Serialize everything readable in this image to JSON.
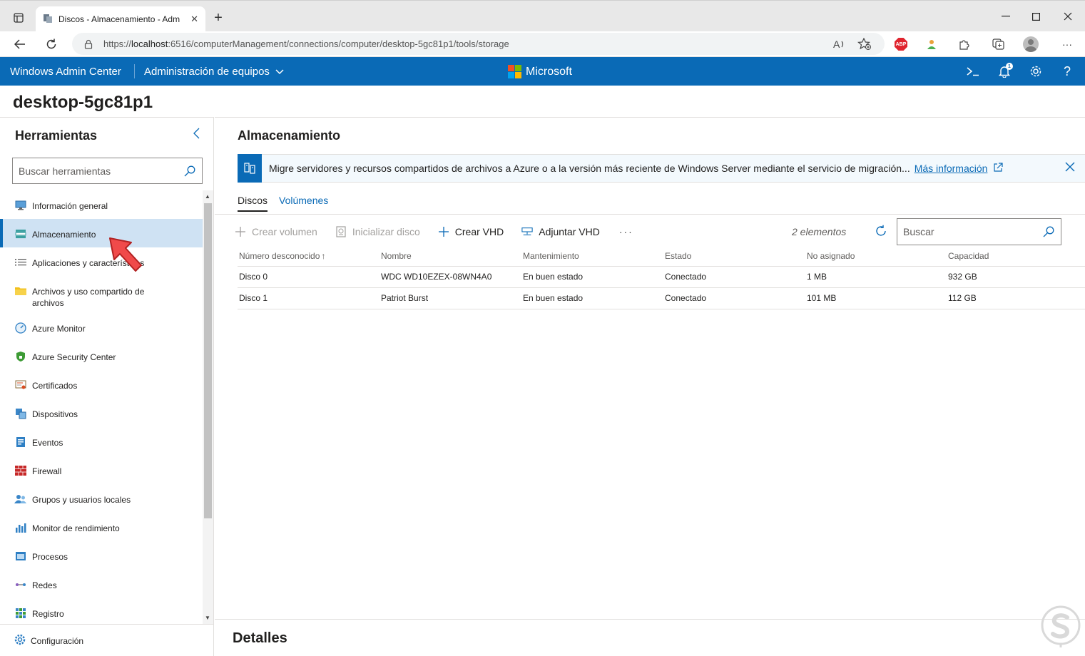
{
  "browser": {
    "tab_title": "Discos - Almacenamiento - Adm",
    "url_prefix": "https://",
    "url_host": "localhost",
    "url_rest": ":6516/computerManagement/connections/computer/desktop-5gc81p1/tools/storage"
  },
  "app": {
    "title": "Windows Admin Center",
    "context": "Administración de equipos",
    "brand": "Microsoft",
    "notification_count": "1",
    "accent_color": "#0a6ab6"
  },
  "machine_name": "desktop-5gc81p1",
  "sidebar": {
    "title": "Herramientas",
    "search_placeholder": "Buscar herramientas",
    "items": [
      {
        "label": "Información general",
        "icon": "monitor-icon"
      },
      {
        "label": "Almacenamiento",
        "icon": "storage-icon"
      },
      {
        "label": "Aplicaciones y características",
        "icon": "list-icon"
      },
      {
        "label": "Archivos y uso compartido de archivos",
        "icon": "folder-icon"
      },
      {
        "label": "Azure Monitor",
        "icon": "gauge-icon"
      },
      {
        "label": "Azure Security Center",
        "icon": "shield-icon"
      },
      {
        "label": "Certificados",
        "icon": "certificate-icon"
      },
      {
        "label": "Dispositivos",
        "icon": "devices-icon"
      },
      {
        "label": "Eventos",
        "icon": "event-log-icon"
      },
      {
        "label": "Firewall",
        "icon": "firewall-icon"
      },
      {
        "label": "Grupos y usuarios locales",
        "icon": "users-icon"
      },
      {
        "label": "Monitor de rendimiento",
        "icon": "chart-icon"
      },
      {
        "label": "Procesos",
        "icon": "process-icon"
      },
      {
        "label": "Redes",
        "icon": "network-icon"
      },
      {
        "label": "Registro",
        "icon": "registry-icon"
      }
    ],
    "footer": "Configuración"
  },
  "main": {
    "title": "Almacenamiento",
    "banner": {
      "message": "Migre servidores y recursos compartidos de archivos a Azure o a la versión más reciente de Windows Server mediante el servicio de migración...",
      "link": "Más información"
    },
    "tabs": [
      "Discos",
      "Volúmenes"
    ],
    "commands": {
      "create_volume": "Crear volumen",
      "init_disk": "Inicializar disco",
      "create_vhd": "Crear VHD",
      "attach_vhd": "Adjuntar VHD",
      "more": "···"
    },
    "item_count": "2 elementos",
    "search_placeholder": "Buscar",
    "columns": [
      "Número desconocido",
      "Nombre",
      "Mantenimiento",
      "Estado",
      "No asignado",
      "Capacidad"
    ],
    "rows": [
      [
        "Disco 0",
        "WDC WD10EZEX-08WN4A0",
        "En buen estado",
        "Conectado",
        "1 MB",
        "932 GB"
      ],
      [
        "Disco 1",
        "Patriot Burst",
        "En buen estado",
        "Conectado",
        "101 MB",
        "112 GB"
      ]
    ],
    "details_title": "Detalles"
  }
}
